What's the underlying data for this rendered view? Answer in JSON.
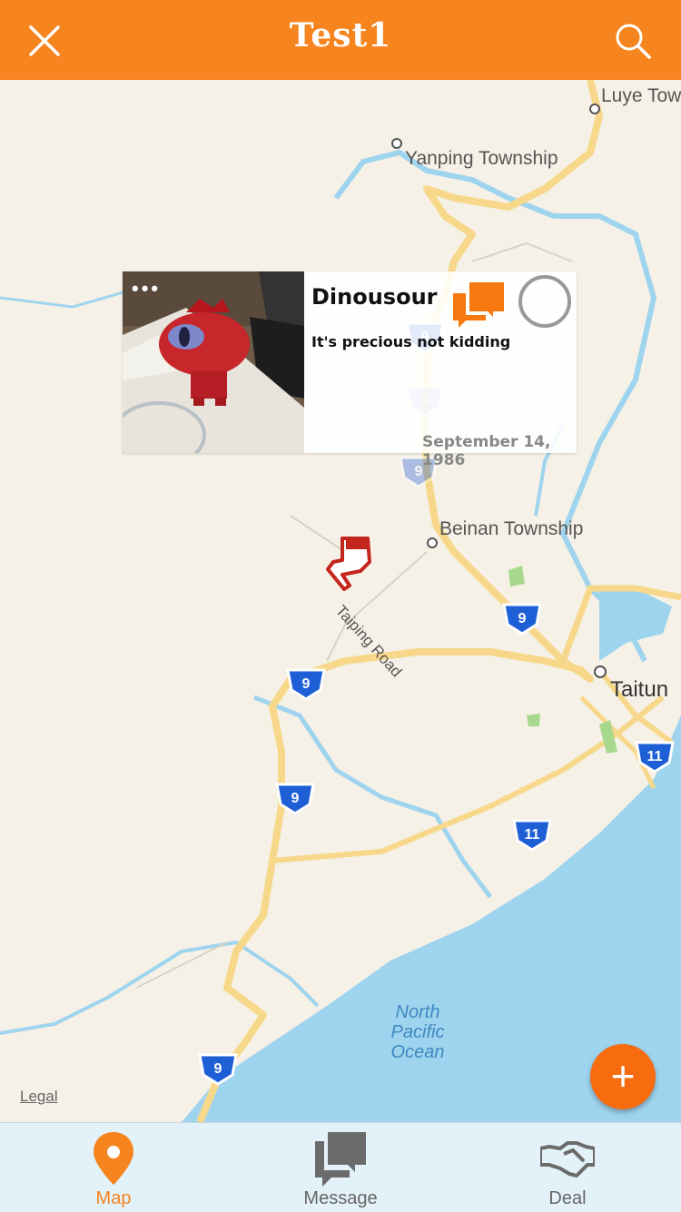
{
  "header": {
    "title": "Test1",
    "close_icon": "close-icon",
    "search_icon": "search-icon",
    "bg_color": "#f6841f"
  },
  "map": {
    "place_labels": {
      "luye": "Luye Tow",
      "yanping": "Yanping Township",
      "beinan": "Beinan Township",
      "taitung": "Taitun",
      "taiping_road": "Taiping Road"
    },
    "ocean_label": {
      "line1": "North",
      "line2": "Pacific",
      "line3": "Ocean"
    },
    "route_shields": [
      "9",
      "9",
      "9",
      "9",
      "9",
      "9",
      "9",
      "11",
      "11"
    ],
    "legal": "Legal"
  },
  "card": {
    "title": "Dinousour",
    "subtitle": "It's precious not kidding",
    "date": "September 14, 1986",
    "more_icon": "ellipsis-icon",
    "chat_icon": "chat-bubbles-icon",
    "select_icon": "empty-circle-icon"
  },
  "fab": {
    "label": "+"
  },
  "tabs": [
    {
      "label": "Map",
      "icon": "map-pin-icon",
      "active": true
    },
    {
      "label": "Message",
      "icon": "message-icon",
      "active": false
    },
    {
      "label": "Deal",
      "icon": "handshake-icon",
      "active": false
    }
  ],
  "colors": {
    "accent": "#f6841f",
    "shield": "#1e5fd6",
    "water": "#9fd4ef",
    "road": "#f7d88a"
  }
}
